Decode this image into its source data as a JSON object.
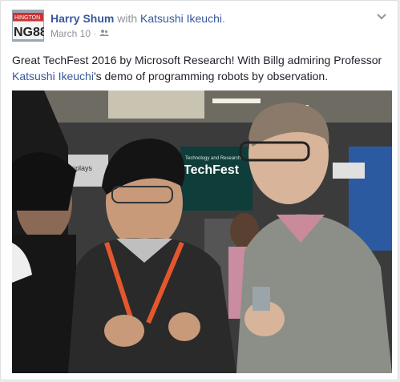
{
  "post": {
    "author": "Harry Shum",
    "with_word": "with",
    "tagged_user": "Katsushi Ikeuchi",
    "trailing_punct": ".",
    "date": "March 10",
    "date_sep": "·",
    "audience_icon": "friends-icon",
    "menu_icon": "chevron-down-icon",
    "avatar_text": "HINGTON",
    "avatar_plate": "NG88",
    "text_part1": "Great TechFest 2016 by Microsoft Research! With Billg admiring Professor ",
    "text_link": "Katsushi Ikeuchi",
    "text_part2": "'s demo of programming robots by observation.",
    "photo_sign_1": "Technology and Research",
    "photo_sign_2": "TechFest",
    "photo_sign_3": "Displays"
  },
  "colors": {
    "link": "#365899",
    "muted": "#90949c",
    "text": "#1d2129",
    "lanyard": "#e4572e"
  }
}
